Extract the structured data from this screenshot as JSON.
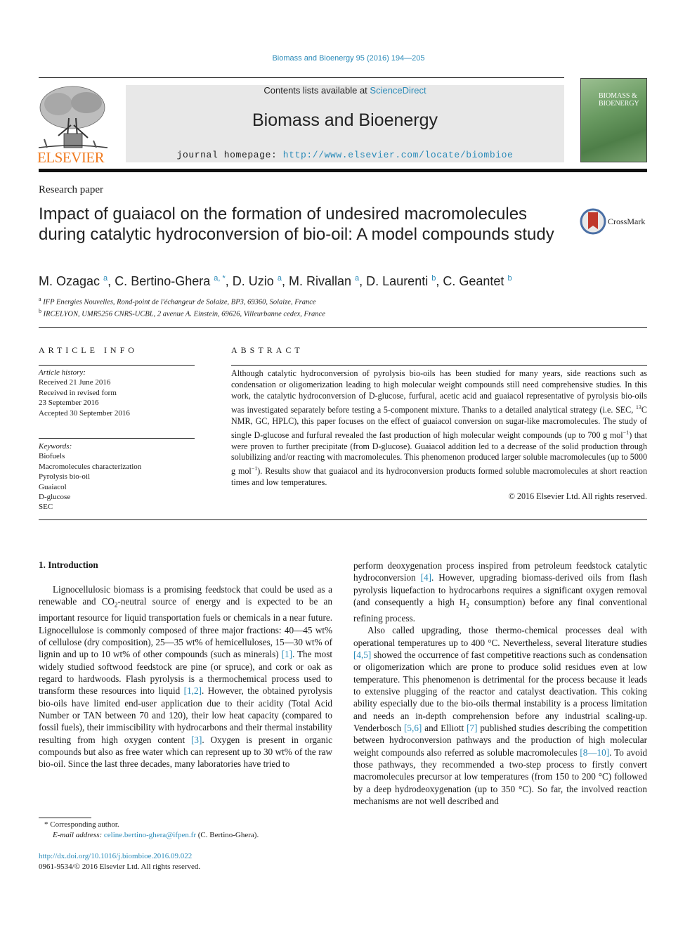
{
  "header": {
    "journal_ref": "Biomass and Bioenergy 95 (2016) 194—205",
    "contents_prefix": "Contents lists available at ",
    "contents_link": "ScienceDirect",
    "journal_title": "Biomass and Bioenergy",
    "homepage_prefix": "journal homepage: ",
    "homepage_url": "http://www.elsevier.com/locate/biombioe",
    "publisher_logo_text": "ELSEVIER",
    "cover_title_line1": "BIOMASS &",
    "cover_title_line2": "BIOENERGY"
  },
  "article": {
    "type": "Research paper",
    "title": "Impact of guaiacol on the formation of undesired macromolecules during catalytic hydroconversion of bio-oil: A model compounds study",
    "crossmark_label": "CrossMark",
    "authors": [
      {
        "name": "M. Ozagac",
        "sup": "a"
      },
      {
        "name": "C. Bertino-Ghera",
        "sup": "a, *"
      },
      {
        "name": "D. Uzio",
        "sup": "a"
      },
      {
        "name": "M. Rivallan",
        "sup": "a"
      },
      {
        "name": "D. Laurenti",
        "sup": "b"
      },
      {
        "name": "C. Geantet",
        "sup": "b"
      }
    ],
    "affiliations": [
      {
        "key": "a",
        "text": "IFP Energies Nouvelles, Rond-point de l'échangeur de Solaize, BP3, 69360, Solaize, France"
      },
      {
        "key": "b",
        "text": "IRCELYON, UMR5256 CNRS-UCBL, 2 avenue A. Einstein, 69626, Villeurbanne cedex, France"
      }
    ]
  },
  "article_info": {
    "heading": "ARTICLE INFO",
    "history_label": "Article history:",
    "history": [
      "Received 21 June 2016",
      "Received in revised form",
      "23 September 2016",
      "Accepted 30 September 2016"
    ],
    "keywords_label": "Keywords:",
    "keywords": [
      "Biofuels",
      "Macromolecules characterization",
      "Pyrolysis bio-oil",
      "Guaiacol",
      "D-glucose",
      "SEC"
    ]
  },
  "abstract": {
    "heading": "ABSTRACT",
    "p1": "Although catalytic hydroconversion of pyrolysis bio-oils has been studied for many years, side reactions such as condensation or oligomerization leading to high molecular weight compounds still need comprehensive studies. In this work, the catalytic hydroconversion of D-glucose, furfural, acetic acid and guaiacol representative of pyrolysis bio-oils was investigated separately before testing a 5-component mixture. Thanks to a detailed analytical strategy (i.e. SEC, ",
    "sup13": "13",
    "p2": "C NMR, GC, HPLC), this paper focuses on the effect of guaiacol conversion on sugar-like macromolecules. The study of single D-glucose and furfural revealed the fast production of high molecular weight compounds (up to 700 g mol",
    "supm1a": "−1",
    "p3": ") that were proven to further precipitate (from D-glucose). Guaiacol addition led to a decrease of the solid production through solubilizing and/or reacting with macromolecules. This phenomenon produced larger soluble macromolecules (up to 5000 g mol",
    "supm1b": "−1",
    "p4": "). Results show that guaiacol and its hydroconversion products formed soluble macromolecules at short reaction times and low temperatures.",
    "copyright": "© 2016 Elsevier Ltd. All rights reserved."
  },
  "intro": {
    "heading": "1.  Introduction",
    "left_a": "Lignocellulosic biomass is a promising feedstock that could be used as a renewable and CO",
    "left_sub2": "2",
    "left_b": "-neutral source of energy and is expected to be an important resource for liquid transportation fuels or chemicals in a near future. Lignocellulose is commonly composed of three major fractions: 40—45 wt% of cellulose (dry composition), 25—35 wt% of hemicelluloses, 15—30 wt% of lignin and up to 10 wt% of other compounds (such as minerals) ",
    "ref1": "[1]",
    "left_c": ". The most widely studied softwood feedstock are pine (or spruce), and cork or oak as regard to hardwoods. Flash pyrolysis is a thermochemical process used to transform these resources into liquid ",
    "ref12": "[1,2]",
    "left_d": ". However, the obtained pyrolysis bio-oils have limited end-user application due to their acidity (Total Acid Number or TAN between 70 and 120), their low heat capacity (compared to fossil fuels), their immiscibility with hydrocarbons and their thermal instability resulting from high oxygen content ",
    "ref3": "[3]",
    "left_e": ". Oxygen is present in organic compounds but also as free water which can represent up to 30 wt% of the raw bio-oil. Since the last three decades, many laboratories have tried to",
    "right_a": "perform deoxygenation process inspired from petroleum feedstock catalytic hydroconversion ",
    "ref4": "[4]",
    "right_b": ". However, upgrading biomass-derived oils from flash pyrolysis liquefaction to hydrocarbons requires a significant oxygen removal (and consequently a high H",
    "right_sub2": "2",
    "right_c": " consumption) before any final conventional refining process.",
    "right2_a": "Also called upgrading, those thermo-chemical processes deal with operational temperatures up to 400 °C. Nevertheless, several literature studies ",
    "ref45": "[4,5]",
    "right2_b": " showed the occurrence of fast competitive reactions such as condensation or oligomerization which are prone to produce solid residues even at low temperature. This phenomenon is detrimental for the process because it leads to extensive plugging of the reactor and catalyst deactivation. This coking ability especially due to the bio-oils thermal instability is a process limitation and needs an in-depth comprehension before any industrial scaling-up. Venderbosch ",
    "ref56": "[5,6]",
    "right2_c": " and Elliott ",
    "ref7": "[7]",
    "right2_d": " published studies describing the competition between hydroconversion pathways and the production of high molecular weight compounds also referred as soluble macromolecules ",
    "ref810": "[8—10]",
    "right2_e": ". To avoid those pathways, they recommended a two-step process to firstly convert macromolecules precursor at low temperatures (from 150 to 200 °C) followed by a deep hydrodeoxygenation (up to 350 °C). So far, the involved reaction mechanisms are not well described and"
  },
  "footnote": {
    "star": "*",
    "corresponding": " Corresponding author.",
    "email_label": "E-mail address: ",
    "email": "celine.bertino-ghera@ifpen.fr",
    "email_suffix": " (C. Bertino-Ghera).",
    "doi": "http://dx.doi.org/10.1016/j.biombioe.2016.09.022",
    "issn_line": "0961-9534/© 2016 Elsevier Ltd. All rights reserved."
  },
  "colors": {
    "link": "#2a8ab8",
    "elsevier_orange": "#f07a1e",
    "masthead_bg": "#e8e8e8",
    "cover_green": "#6a9b62",
    "crossmark_red": "#c0392b"
  }
}
